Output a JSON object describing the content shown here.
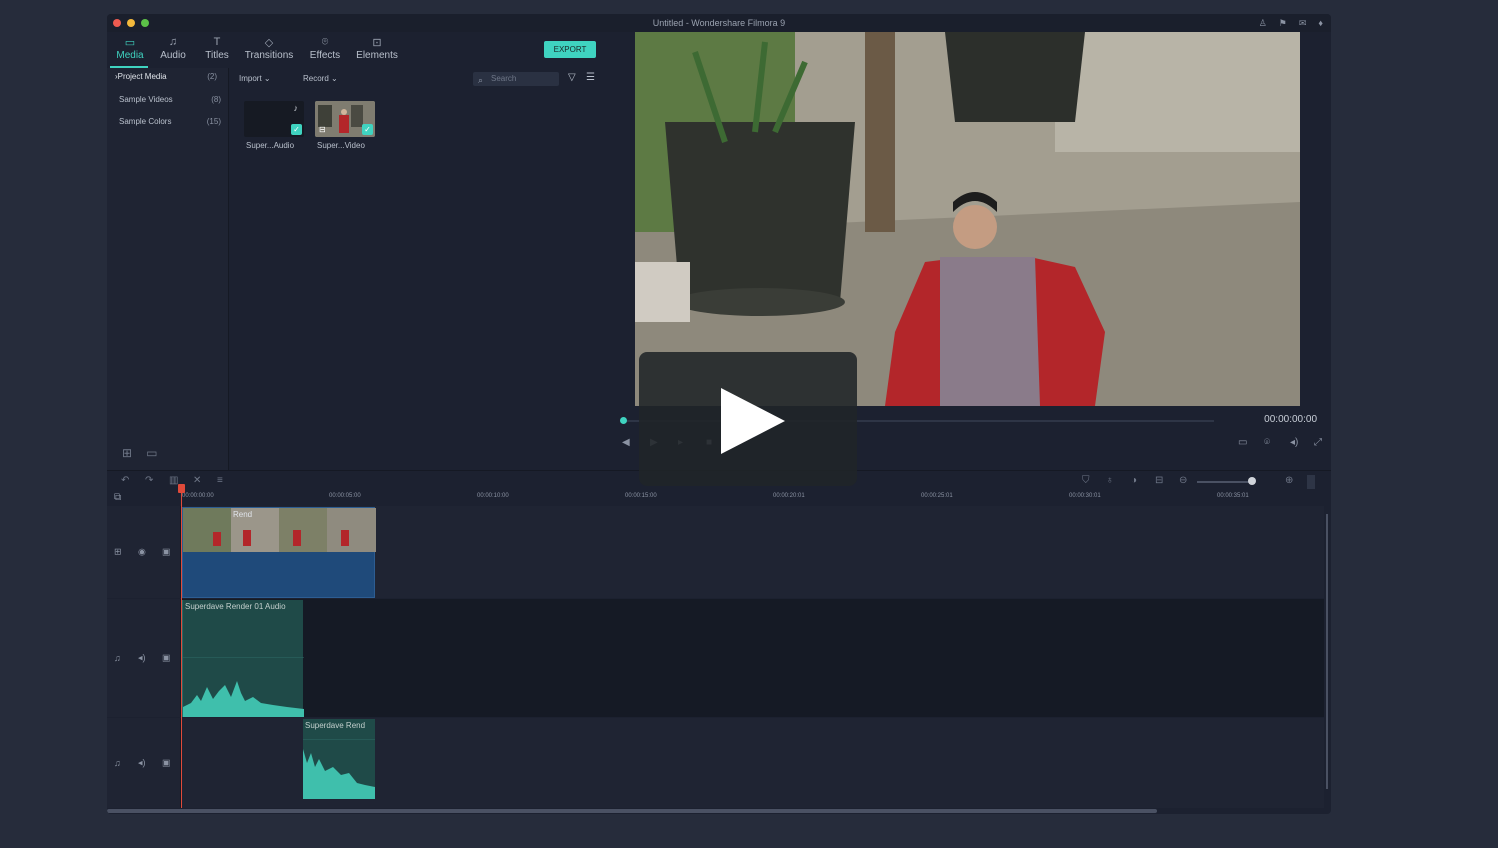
{
  "window": {
    "title": "Untitled - Wondershare Filmora 9"
  },
  "tabs": [
    {
      "label": "Media",
      "icon": "folder-icon"
    },
    {
      "label": "Audio",
      "icon": "music-note-icon"
    },
    {
      "label": "Titles",
      "icon": "text-icon"
    },
    {
      "label": "Transitions",
      "icon": "transitions-icon"
    },
    {
      "label": "Effects",
      "icon": "effects-icon"
    },
    {
      "label": "Elements",
      "icon": "elements-icon"
    }
  ],
  "export_label": "EXPORT",
  "sidebar": {
    "items": [
      {
        "label": "Project Media",
        "count": "(2)"
      },
      {
        "label": "Sample Videos",
        "count": "(8)"
      },
      {
        "label": "Sample Colors",
        "count": "(15)"
      }
    ]
  },
  "media": {
    "import_label": "Import",
    "record_label": "Record",
    "search_placeholder": "Search",
    "thumbs": [
      {
        "caption": "Super...Audio"
      },
      {
        "caption": "Super...Video"
      }
    ]
  },
  "preview": {
    "timecode": "00:00:00:00"
  },
  "ruler": [
    "00:00:00:00",
    "00:00:05:00",
    "00:00:10:00",
    "00:00:15:00",
    "00:00:20:01",
    "00:00:25:01",
    "00:00:30:01",
    "00:00:35:01"
  ],
  "clips": {
    "video_title": "Rend",
    "audio1_title": "Superdave Render 01 Audio",
    "audio2_title": "Superdave Rend"
  },
  "colors": {
    "accent": "#3fd3c0",
    "playhead": "#e04a3a",
    "video_clip": "#1f4a7a",
    "audio_clip": "#1f4a48"
  }
}
